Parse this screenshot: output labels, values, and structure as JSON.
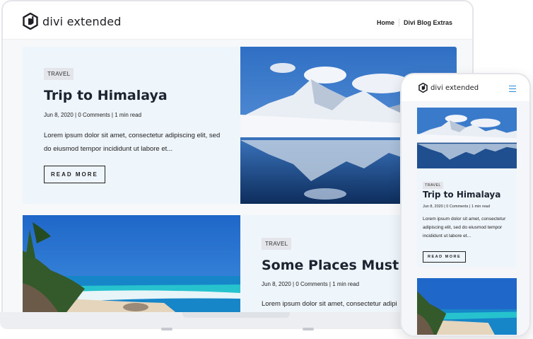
{
  "site": {
    "brand": "divi extended"
  },
  "nav": {
    "items": [
      "Home",
      "Divi Blog Extras"
    ]
  },
  "posts": [
    {
      "category": "TRAVEL",
      "title": "Trip to Himalaya",
      "date": "Jun 8, 2020",
      "comments": "0 Comments",
      "read_time": "1 min read",
      "excerpt": "Lorem ipsum dolor sit amet, consectetur adipiscing elit, sed do eiusmod tempor incididunt ut labore et...",
      "button": "READ MORE"
    },
    {
      "category": "TRAVEL",
      "title": "Some Places Must Vis",
      "date": "Jun 8, 2020",
      "comments": "0 Comments",
      "read_time": "1 min read",
      "excerpt": "Lorem ipsum dolor sit amet, consectetur adipi"
    }
  ],
  "mobile": {
    "brand": "divi extended",
    "post": {
      "category": "TRAVEL",
      "title": "Trip to Himalaya",
      "date": "Jun 8, 2020",
      "comments": "0 Comments",
      "read_time": "1 min read",
      "excerpt": "Lorem ipsum dolor sit amet, consectetur adipiscing elit, sed do eiusmod tempor incididunt ut labore et...",
      "button": "READ MORE"
    }
  },
  "colors": {
    "accent": "#2a8cd8",
    "card_bg": "#eef5fb",
    "text": "#1d2430"
  }
}
